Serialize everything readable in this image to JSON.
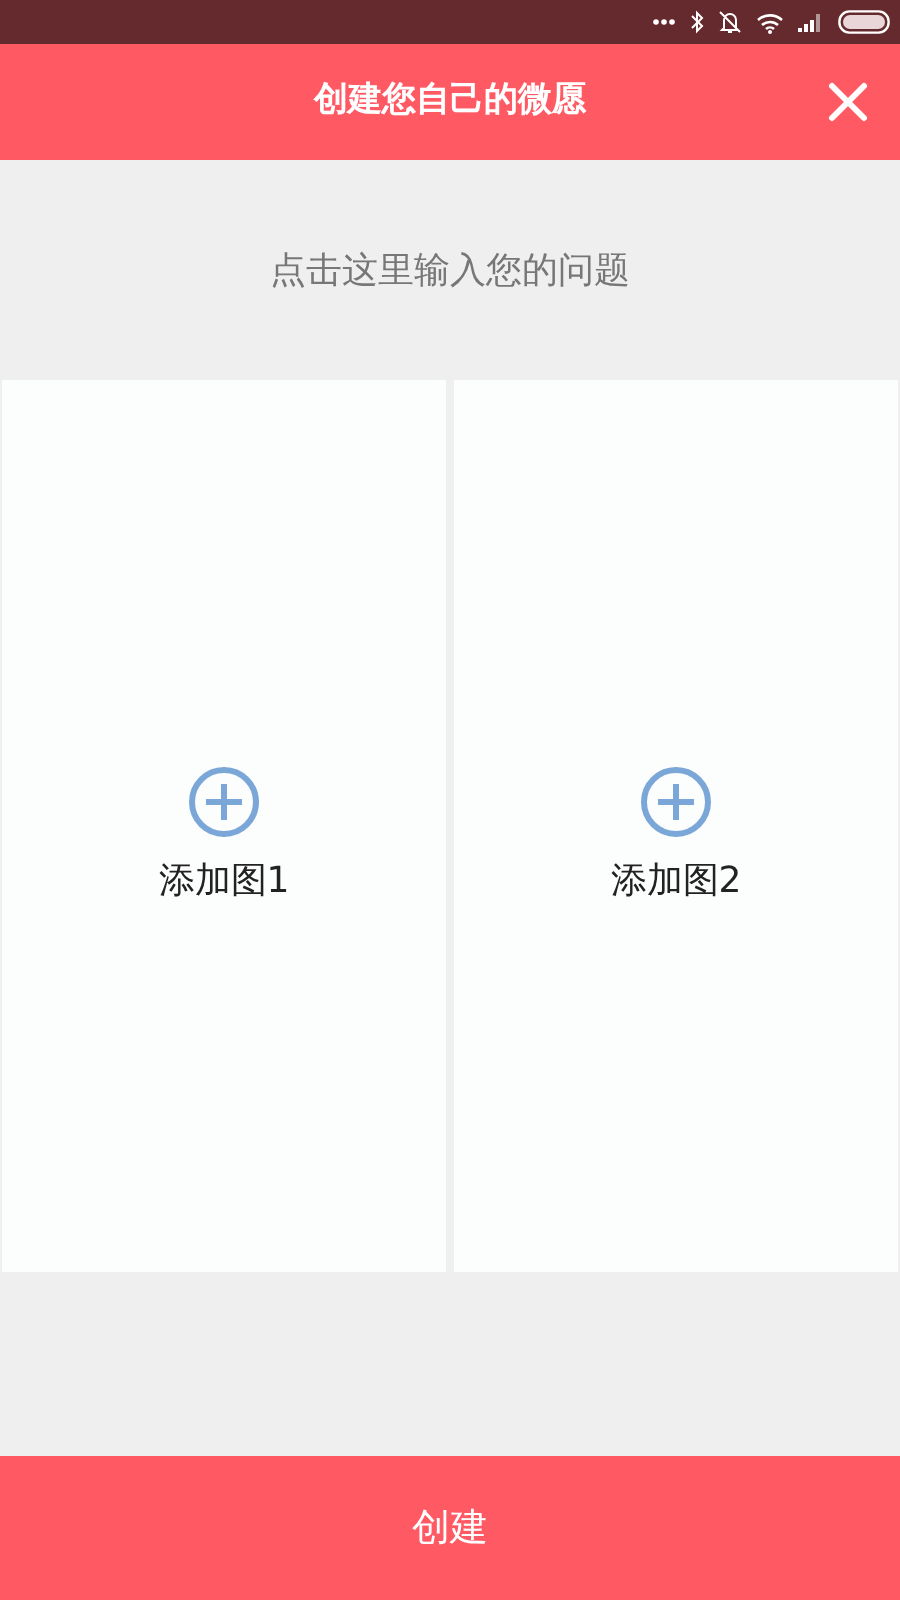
{
  "header": {
    "title": "创建您自己的微愿"
  },
  "question": {
    "placeholder": "点击这里输入您的问题"
  },
  "image_slots": [
    {
      "label": "添加图1"
    },
    {
      "label": "添加图2"
    }
  ],
  "create_button": {
    "label": "创建"
  }
}
